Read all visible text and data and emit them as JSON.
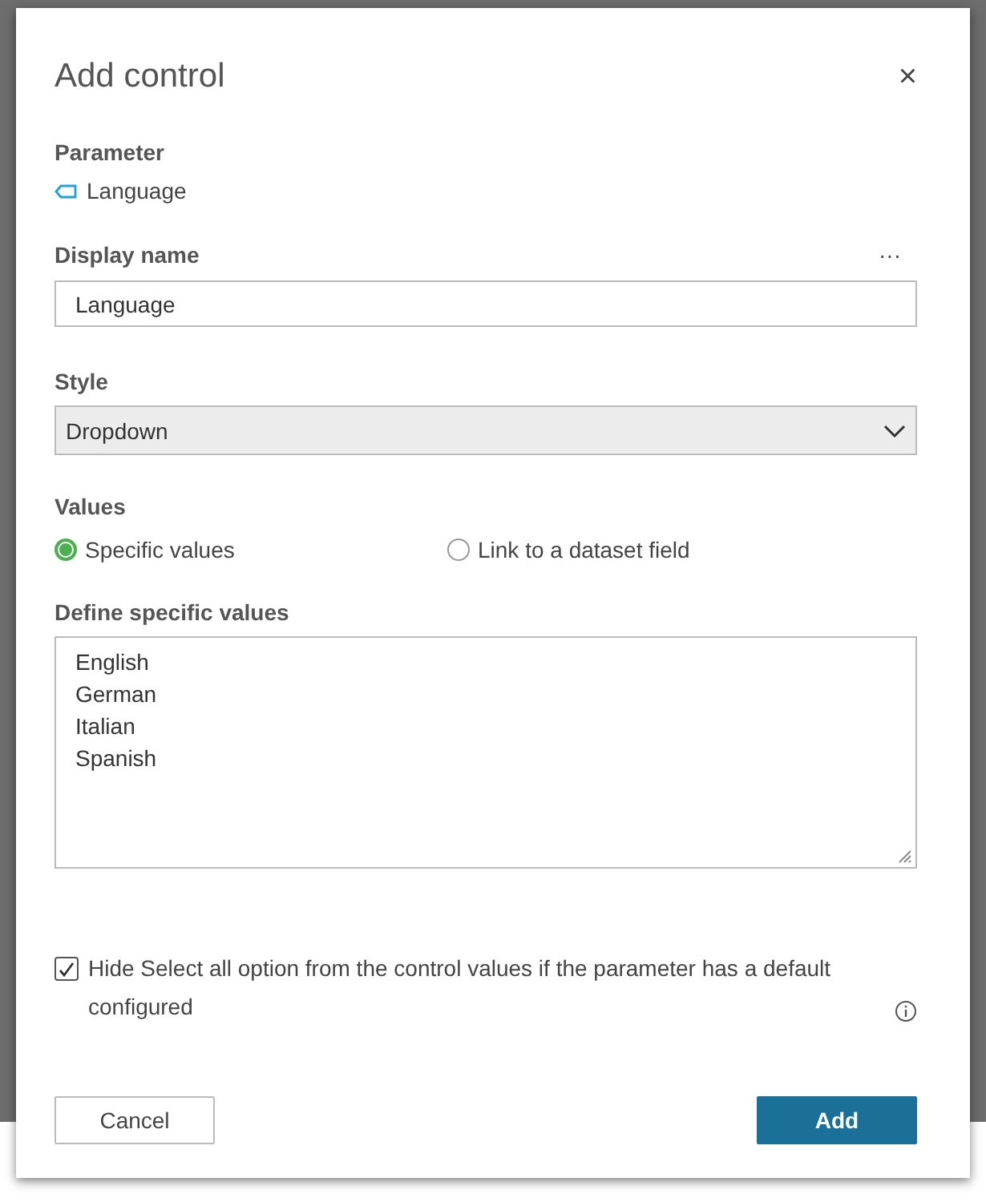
{
  "dialog": {
    "title": "Add control",
    "close": "×"
  },
  "parameter": {
    "label": "Parameter",
    "name": "Language"
  },
  "display_name": {
    "label": "Display name",
    "more": "···",
    "value": "Language"
  },
  "style": {
    "label": "Style",
    "value": "Dropdown"
  },
  "values": {
    "label": "Values",
    "options": [
      {
        "label": "Specific values",
        "selected": true
      },
      {
        "label": "Link to a dataset field",
        "selected": false
      }
    ]
  },
  "specific_values": {
    "label": "Define specific values",
    "lines": [
      "English",
      "German",
      "Italian",
      "Spanish"
    ]
  },
  "hide_select_all": {
    "label": "Hide Select all option from the control values if the parameter has a default configured",
    "checked": true
  },
  "buttons": [
    {
      "label": "Cancel",
      "kind": "secondary"
    },
    {
      "label": "Add",
      "kind": "primary"
    }
  ]
}
